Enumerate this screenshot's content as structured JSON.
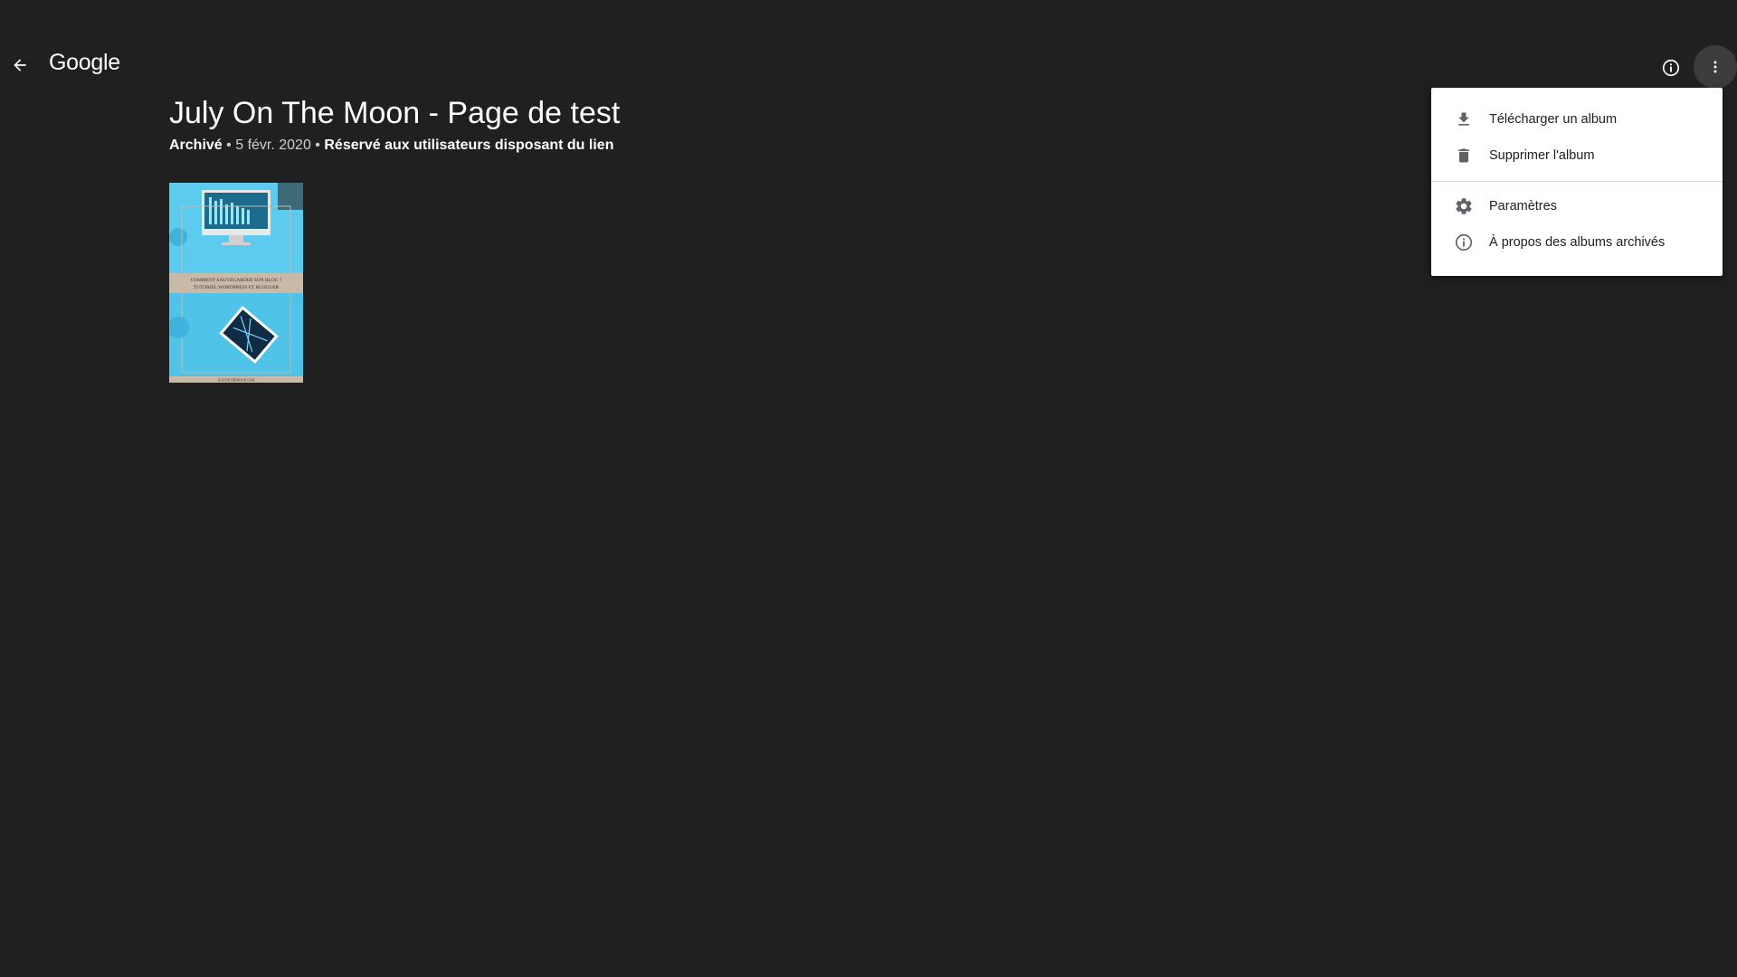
{
  "header": {
    "logo_text": "Google",
    "back_icon": "arrow-back-icon",
    "info_icon": "info-icon",
    "more_icon": "more-vert-icon"
  },
  "album": {
    "title": "July On The Moon - Page de test",
    "status": "Archivé",
    "separator": "•",
    "date": "5 févr. 2020",
    "sharing": "Réservé aux utilisateurs disposant du lien"
  },
  "photo": {
    "caption_line1": "COMMENT SAUVEGARDER SON BLOG ?",
    "caption_line2": "TUTORIEL WORDPRESS ET BLOGGER",
    "footer": "JULYONTHEMOON.COM"
  },
  "menu": {
    "items": [
      {
        "label": "Télécharger un album",
        "icon": "download-icon"
      },
      {
        "label": "Supprimer l'album",
        "icon": "trash-icon"
      },
      {
        "label": "Paramètres",
        "icon": "gear-icon"
      },
      {
        "label": "À propos des albums archivés",
        "icon": "info-icon"
      }
    ]
  },
  "colors": {
    "background": "#202020",
    "menu_background": "#ffffff",
    "photo_background": "#4fc3e8"
  }
}
